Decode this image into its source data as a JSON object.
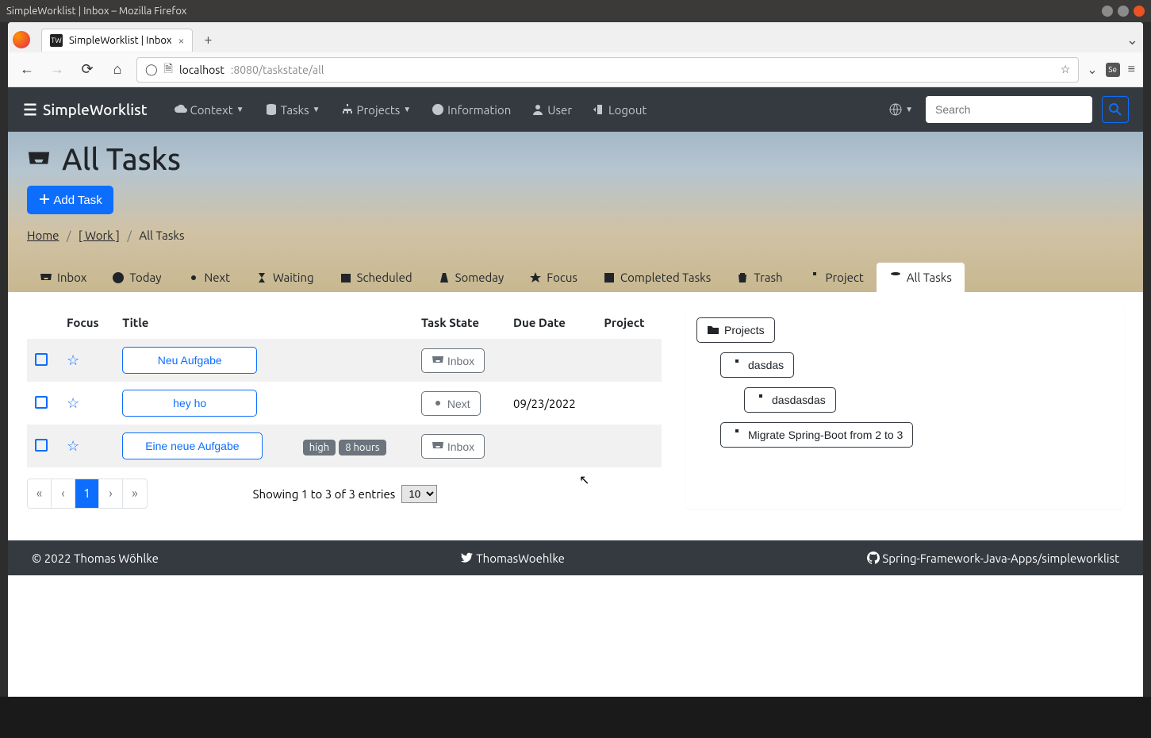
{
  "os": {
    "window_title": "SimpleWorklist | Inbox – Mozilla Firefox"
  },
  "browser": {
    "tab_title": "SimpleWorklist | Inbox",
    "url_host": "localhost",
    "url_port_path": ":8080/taskstate/all"
  },
  "navbar": {
    "brand": "SimpleWorklist",
    "context": "Context",
    "tasks": "Tasks",
    "projects": "Projects",
    "information": "Information",
    "user": "User",
    "logout": "Logout",
    "search_placeholder": "Search"
  },
  "page": {
    "title": "All Tasks",
    "add_task": "Add Task",
    "breadcrumb_home": "Home",
    "breadcrumb_work": "[ Work ]",
    "breadcrumb_current": "All Tasks"
  },
  "tabs": {
    "inbox": "Inbox",
    "today": "Today",
    "next": "Next",
    "waiting": "Waiting",
    "scheduled": "Scheduled",
    "someday": "Someday",
    "focus": "Focus",
    "completed": "Completed Tasks",
    "trash": "Trash",
    "project": "Project",
    "all": "All Tasks"
  },
  "table": {
    "col_focus": "Focus",
    "col_title": "Title",
    "col_state": "Task State",
    "col_due": "Due Date",
    "col_project": "Project",
    "rows": [
      {
        "title": "Neu Aufgabe",
        "badges": [],
        "state": "Inbox",
        "state_icon": "inbox",
        "due": ""
      },
      {
        "title": "hey ho",
        "badges": [],
        "state": "Next",
        "state_icon": "cog",
        "due": "09/23/2022"
      },
      {
        "title": "Eine neue Aufgabe",
        "badges": [
          "high",
          "8 hours"
        ],
        "state": "Inbox",
        "state_icon": "inbox",
        "due": ""
      }
    ],
    "showing": "Showing 1 to 3 of 3 entries",
    "page_size": "10"
  },
  "project_tree": {
    "root": "Projects",
    "items": [
      "dasdas",
      "dasdasdas",
      "Migrate Spring-Boot from 2 to 3"
    ]
  },
  "footer": {
    "copyright": "© 2022 Thomas Wöhlke",
    "twitter": "ThomasWoehlke",
    "github": "Spring-Framework-Java-Apps/simpleworklist"
  }
}
